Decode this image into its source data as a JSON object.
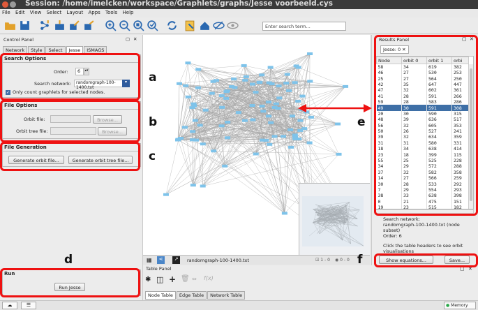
{
  "window": {
    "title": "Session: /home/imelcken/workspace/Graphlets/graphs/Jesse voorbeeld.cys"
  },
  "menu": [
    "File",
    "Edit",
    "View",
    "Select",
    "Layout",
    "Apps",
    "Tools",
    "Help"
  ],
  "toolbar": {
    "search_placeholder": "Enter search term..."
  },
  "control_panel": {
    "title": "Control Panel",
    "tabs": [
      "Network",
      "Style",
      "Select",
      "Jesse",
      "ISMAGS"
    ],
    "selected_tab": "Jesse",
    "search_options": {
      "title": "Search Options",
      "order_label": "Order:",
      "order_value": "6",
      "network_label": "Search network:",
      "network_value": "randomgraph-100-1400.txt",
      "checkbox_label": "Only count graphlets for selected nodes."
    },
    "file_options": {
      "title": "File Options",
      "orbit_file_label": "Orbit file:",
      "orbit_tree_label": "Orbit tree file:",
      "browse_label": "Browse..."
    },
    "file_generation": {
      "title": "File Generation",
      "gen_orbit_label": "Generate orbit file...",
      "gen_tree_label": "Generate orbit tree file..."
    },
    "run": {
      "title": "Run",
      "button_label": "Run Jesse"
    }
  },
  "annotations": {
    "a": "a",
    "b": "b",
    "c": "c",
    "d": "d",
    "e": "e",
    "f": "f"
  },
  "network_view": {
    "network_name": "randomgraph-100-1400.txt",
    "sel_count": "1 - 0",
    "hidden_count": "0 - 0"
  },
  "table_panel": {
    "title": "Table Panel",
    "tabs": [
      "Node Table",
      "Edge Table",
      "Network Table"
    ],
    "fx": "f(x)"
  },
  "results_panel": {
    "title": "Results Panel",
    "tab_label": "Jesse: 0",
    "columns": [
      "Node",
      "orbit 0",
      "orbit 1",
      "orbi"
    ],
    "rows": [
      [
        "58",
        "34",
        "619",
        "382"
      ],
      [
        "46",
        "27",
        "530",
        "253"
      ],
      [
        "25",
        "27",
        "564",
        "250"
      ],
      [
        "42",
        "35",
        "647",
        "447"
      ],
      [
        "47",
        "32",
        "602",
        "361"
      ],
      [
        "41",
        "28",
        "591",
        "266"
      ],
      [
        "59",
        "28",
        "583",
        "286"
      ],
      [
        "49",
        "30",
        "591",
        "308"
      ],
      [
        "20",
        "30",
        "590",
        "315"
      ],
      [
        "48",
        "39",
        "636",
        "517"
      ],
      [
        "56",
        "32",
        "605",
        "353"
      ],
      [
        "50",
        "26",
        "527",
        "241"
      ],
      [
        "39",
        "32",
        "634",
        "359"
      ],
      [
        "31",
        "31",
        "580",
        "331"
      ],
      [
        "18",
        "34",
        "638",
        "414"
      ],
      [
        "23",
        "18",
        "399",
        "115"
      ],
      [
        "55",
        "25",
        "525",
        "228"
      ],
      [
        "34",
        "29",
        "572",
        "288"
      ],
      [
        "37",
        "32",
        "582",
        "358"
      ],
      [
        "14",
        "27",
        "566",
        "259"
      ],
      [
        "30",
        "28",
        "533",
        "292"
      ],
      [
        "7",
        "29",
        "554",
        "293"
      ],
      [
        "38",
        "33",
        "638",
        "398"
      ],
      [
        "0",
        "21",
        "475",
        "151"
      ],
      [
        "19",
        "23",
        "515",
        "182"
      ]
    ],
    "selected_row": 7,
    "info_lines": [
      "Search network:",
      "randomgraph-100-1400.txt (node",
      "subset)",
      "Order: 6"
    ],
    "hint_lines": [
      "Click the table headers to see orbit",
      "visualisations"
    ],
    "show_eq_label": "Show equations...",
    "save_label": "Save..."
  },
  "status": {
    "memory_label": "Memory"
  },
  "colors": {
    "accent": "#3e6fa6",
    "annotation_red": "#ee1111",
    "node_blue": "#7ec3ea"
  }
}
